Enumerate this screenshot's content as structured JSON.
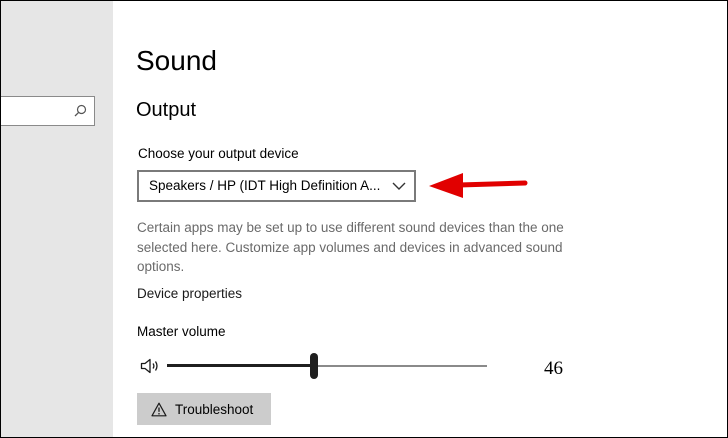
{
  "page": {
    "title": "Sound"
  },
  "sidebar": {
    "search": {
      "value": "",
      "icon": "search-icon"
    }
  },
  "output": {
    "heading": "Output",
    "choose_label": "Choose your output device",
    "selected_device": "Speakers / HP (IDT High Definition A...",
    "dropdown_icon": "chevron-down-icon",
    "info_text": "Certain apps may be set up to use different sound devices than the one selected here. Customize app volumes and devices in advanced sound options.",
    "device_properties_link": "Device properties",
    "master_volume_label": "Master volume",
    "volume_icon": "speaker-icon",
    "volume_value": "46",
    "volume_level_percent": 46,
    "troubleshoot_label": "Troubleshoot",
    "troubleshoot_icon": "warning-icon"
  },
  "annotation": {
    "arrow_color": "#e10000",
    "arrow_icon": "red-arrow-annotation"
  },
  "colors": {
    "sidebar_bg": "#e6e6e6",
    "button_bg": "#cccccc",
    "secondary_text": "#6a6a6a"
  }
}
